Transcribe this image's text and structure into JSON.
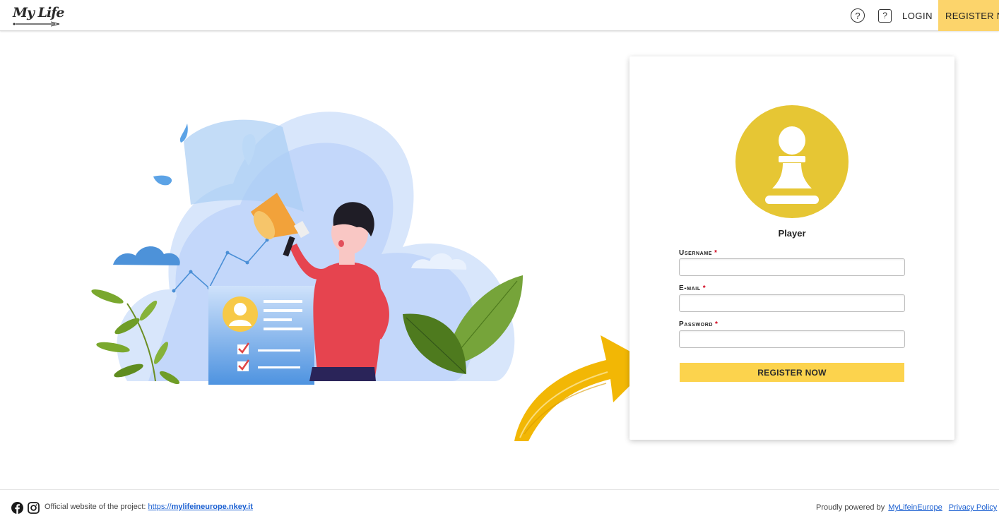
{
  "header": {
    "logo_text": "My Life",
    "help_icon": "question-circle-icon",
    "faq_icon": "question-square-icon",
    "login_label": "LOGIN",
    "register_label": "REGISTER NOW"
  },
  "form": {
    "avatar_icon": "chess-pawn-icon",
    "role_label": "Player",
    "username_label": "Username",
    "email_label": "E-mail",
    "password_label": "Password",
    "required_mark": "*",
    "username_value": "",
    "email_value": "",
    "password_value": "",
    "submit_label": "REGISTER NOW"
  },
  "footer": {
    "facebook_icon": "facebook-icon",
    "instagram_icon": "instagram-icon",
    "official_text": "Official website of the project:",
    "link_prefix": "https://",
    "link_domain": "mylifeineurope.nkey.it",
    "powered_text": "Proudly powered by",
    "powered_link": "MyLifeinEurope",
    "privacy_link": "Privacy Policy"
  },
  "colors": {
    "accent_yellow": "#fcd34d",
    "avatar_yellow": "#e6c634",
    "arrow_yellow": "#f2b705",
    "link_blue": "#1a5fd1",
    "required_red": "#d0021b"
  }
}
